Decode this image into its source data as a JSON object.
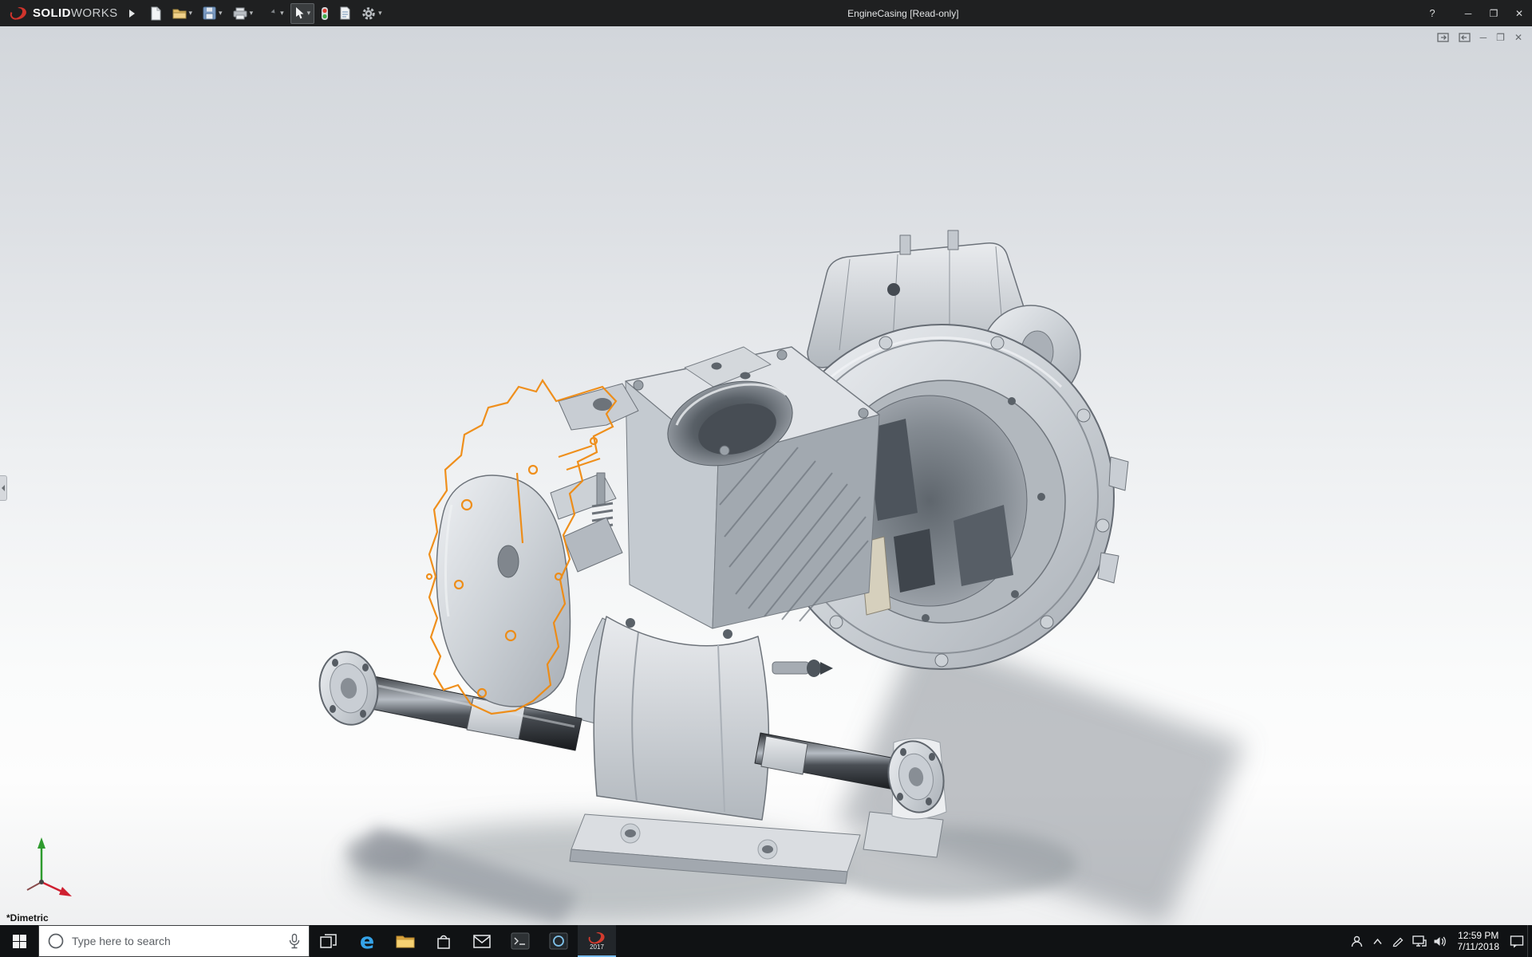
{
  "titlebar": {
    "brand_solid": "SOLID",
    "brand_works": "WORKS",
    "title": "EngineCasing [Read-only]",
    "help_label": "?",
    "controls": {
      "minimize": "─",
      "maximize": "❐",
      "close": "✕"
    }
  },
  "toolbar": {
    "tools": [
      "new",
      "open",
      "save",
      "print",
      "undo",
      "select",
      "rebuild",
      "file-properties",
      "options"
    ]
  },
  "document_window": {
    "controls": {
      "minimize": "─",
      "restore": "❐",
      "close": "✕"
    }
  },
  "viewport": {
    "orientation": "*Dimetric"
  },
  "taskbar": {
    "search_placeholder": "Type here to search",
    "edge_glyph": "e",
    "solidworks_year": "2017",
    "clock": {
      "time": "12:59 PM",
      "date": "7/11/2018"
    }
  },
  "icons": {
    "dropdown": "▾"
  },
  "colors": {
    "sketch_highlight": "#ef8a10",
    "brand_red": "#d0342c",
    "titlebar_bg": "#1f2021",
    "taskbar_bg": "#101214"
  }
}
